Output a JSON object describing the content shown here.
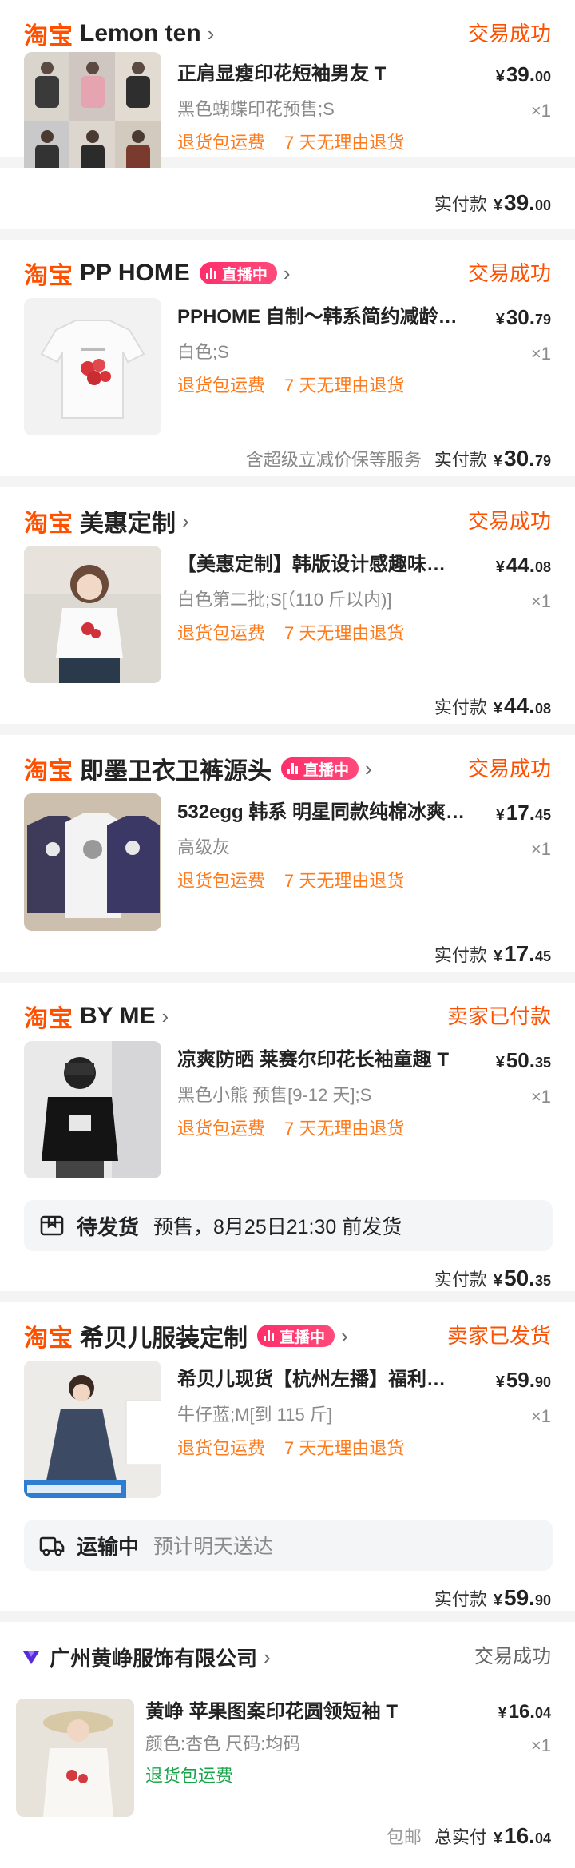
{
  "platform_label": "淘宝",
  "orders": [
    {
      "shop": "Lemon ten",
      "status": "交易成功",
      "title": "正肩显瘦印花短袖男友 T",
      "price_int": "39.",
      "price_dec": "00",
      "spec": "黑色蝴蝶印花预售;S",
      "qty": "×1",
      "services": [
        "退货包运费",
        "7 天无理由退货"
      ],
      "paid_label": "实付款",
      "paid_int": "39.",
      "paid_dec": "00"
    },
    {
      "shop": "PP HOME",
      "live_label": "直播中",
      "status": "交易成功",
      "title": "PPHOME 自制～韩系简约减龄…",
      "price_int": "30.",
      "price_dec": "79",
      "spec": "白色;S",
      "qty": "×1",
      "services": [
        "退货包运费",
        "7 天无理由退货"
      ],
      "note": "含超级立减价保等服务",
      "paid_label": "实付款",
      "paid_int": "30.",
      "paid_dec": "79"
    },
    {
      "shop": "美惠定制",
      "status": "交易成功",
      "title": "【美惠定制】韩版设计感趣味…",
      "price_int": "44.",
      "price_dec": "08",
      "spec": "白色第二批;S[（110 斤以内)]",
      "qty": "×1",
      "services": [
        "退货包运费",
        "7 天无理由退货"
      ],
      "paid_label": "实付款",
      "paid_int": "44.",
      "paid_dec": "08"
    },
    {
      "shop": "即墨卫衣卫裤源头",
      "live_label": "直播中",
      "status": "交易成功",
      "title": "532egg 韩系 明星同款纯棉冰爽…",
      "price_int": "17.",
      "price_dec": "45",
      "spec": "高级灰",
      "qty": "×1",
      "services": [
        "退货包运费",
        "7 天无理由退货"
      ],
      "paid_label": "实付款",
      "paid_int": "17.",
      "paid_dec": "45"
    },
    {
      "shop": "BY ME",
      "status": "卖家已付款",
      "title": "凉爽防晒 莱赛尔印花长袖童趣 T",
      "price_int": "50.",
      "price_dec": "35",
      "spec": "黑色小熊 预售[9-12 天];S",
      "qty": "×1",
      "services": [
        "退货包运费",
        "7 天无理由退货"
      ],
      "info_key": "待发货",
      "info_value": "预售，8月25日21:30 前发货",
      "paid_label": "实付款",
      "paid_int": "50.",
      "paid_dec": "35"
    },
    {
      "shop": "希贝儿服装定制",
      "live_label": "直播中",
      "status": "卖家已发货",
      "title": "希贝儿现货【杭州左播】福利…",
      "price_int": "59.",
      "price_dec": "90",
      "spec": "牛仔蓝;M[到 115 斤]",
      "qty": "×1",
      "services": [
        "退货包运费",
        "7 天无理由退货"
      ],
      "info_key": "运输中",
      "info_value": "预计明天送达",
      "paid_label": "实付款",
      "paid_int": "59.",
      "paid_dec": "90"
    },
    {
      "shop": "广州黄峥服饰有限公司",
      "status": "交易成功",
      "title": "黄峥 苹果图案印花圆领短袖 T",
      "price_int": "16.",
      "price_dec": "04",
      "spec": "颜色:杏色 尺码:均码",
      "qty": "×1",
      "services": [
        "退货包运费"
      ],
      "note": "包邮",
      "paid_label": "总实付",
      "paid_int": "16.",
      "paid_dec": "04"
    }
  ],
  "currency_symbol": "¥",
  "icons": {
    "chevron": "chevron-right-icon",
    "live": "live-bars-icon",
    "pending": "package-box-icon",
    "shipping": "truck-icon",
    "tmall_brand": "tmall-diamond-icon"
  },
  "colors": {
    "taobao_orange": "#ff5000",
    "service_orange": "#ff7a1a",
    "live_pink": "#ff2e6a",
    "tmall_purple": "#5a2bd9",
    "green": "#19a64a"
  }
}
